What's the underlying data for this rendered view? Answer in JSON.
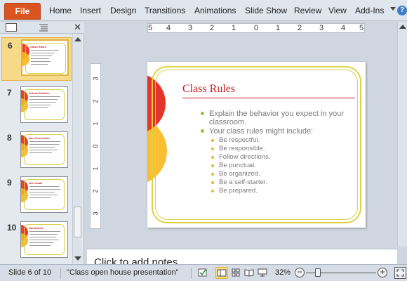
{
  "ribbon": {
    "file_label": "File",
    "tabs": [
      {
        "label": "Home"
      },
      {
        "label": "Insert"
      },
      {
        "label": "Design"
      },
      {
        "label": "Transitions"
      },
      {
        "label": "Animations"
      },
      {
        "label": "Slide Show"
      },
      {
        "label": "Review"
      },
      {
        "label": "View"
      },
      {
        "label": "Add-Ins"
      }
    ],
    "help_label": "?"
  },
  "left_panel": {
    "close_label": "✕",
    "thumbnails": [
      {
        "number": "6",
        "title": "Class Rules",
        "active": true
      },
      {
        "number": "7",
        "title": "School Policies",
        "active": false
      },
      {
        "number": "8",
        "title": "Our Curriculum",
        "active": false
      },
      {
        "number": "9",
        "title": "Our Goals",
        "active": false
      },
      {
        "number": "10",
        "title": "Homework",
        "active": false
      }
    ]
  },
  "ruler": {
    "horizontal": [
      "5",
      "4",
      "3",
      "2",
      "1",
      "0",
      "1",
      "2",
      "3",
      "4",
      "5"
    ],
    "vertical": [
      "3",
      "2",
      "1",
      "0",
      "1",
      "2",
      "3"
    ]
  },
  "slide": {
    "title": "Class Rules",
    "bullets": [
      "Explain the behavior you expect in your classroom.",
      "Your class rules might include:"
    ],
    "sub_bullets": [
      "Be respectful.",
      "Be responsible.",
      "Follow directions.",
      "Be punctual.",
      "Be organized.",
      "Be a self-starter.",
      "Be prepared."
    ],
    "colors": {
      "title": "#c81e24",
      "frame": "#dfd145",
      "circle_red": "#e5352a",
      "circle_orange": "#f8b71c",
      "bullet": "#93c445",
      "sub_bullet": "#f3b51c"
    }
  },
  "notes": {
    "placeholder": "Click to add notes"
  },
  "status": {
    "slide_info": "Slide 6 of 10",
    "theme": "\"Class open house presentation\"",
    "zoom": "32%",
    "zoom_minus": "−",
    "zoom_plus": "+"
  }
}
